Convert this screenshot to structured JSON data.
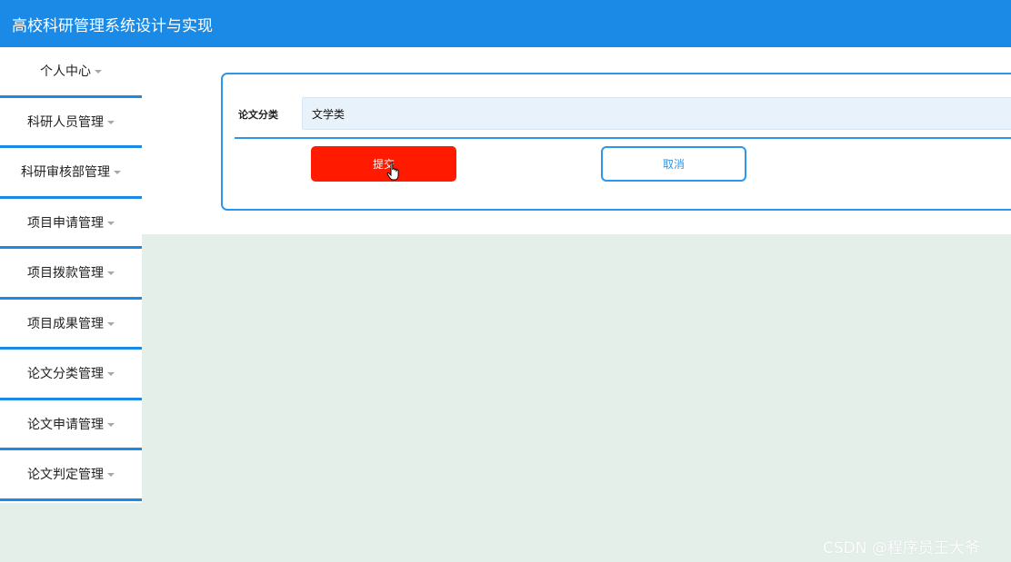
{
  "app": {
    "title": "高校科研管理系统设计与实现"
  },
  "sidebar": {
    "items": [
      {
        "label": "个人中心"
      },
      {
        "label": "科研人员管理"
      },
      {
        "label": "科研审核部管理"
      },
      {
        "label": "项目申请管理"
      },
      {
        "label": "项目拨款管理"
      },
      {
        "label": "项目成果管理"
      },
      {
        "label": "论文分类管理"
      },
      {
        "label": "论文申请管理"
      },
      {
        "label": "论文判定管理"
      }
    ]
  },
  "form": {
    "category_label": "论文分类",
    "category_value": "文学类",
    "submit_label": "提交",
    "cancel_label": "取消"
  },
  "watermark": {
    "text": "CSDN @程序员王大爷"
  },
  "colors": {
    "header": "#1a8ae6",
    "accent": "#2d96e8",
    "submit": "#ff1a00",
    "background": "#e4efea"
  }
}
